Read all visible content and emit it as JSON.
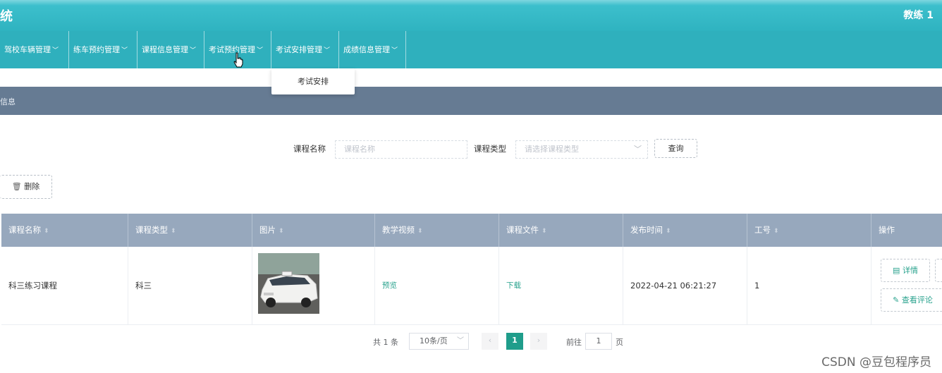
{
  "header": {
    "title": "统",
    "user": "教练 1"
  },
  "nav": {
    "items": [
      {
        "label": "驾校车辆管理"
      },
      {
        "label": "练车预约管理"
      },
      {
        "label": "课程信息管理"
      },
      {
        "label": "考试预约管理"
      },
      {
        "label": "考试安排管理"
      },
      {
        "label": "成绩信息管理"
      }
    ],
    "dropdown_item": "考试安排"
  },
  "section": {
    "title": "信息"
  },
  "search": {
    "course_name_label": "课程名称",
    "course_name_placeholder": "课程名称",
    "course_type_label": "课程类型",
    "course_type_placeholder": "请选择课程类型",
    "query_button": "查询"
  },
  "toolbar": {
    "delete_button": "删除"
  },
  "table": {
    "headers": [
      "课程名称",
      "课程类型",
      "图片",
      "教学视频",
      "课程文件",
      "发布时间",
      "工号",
      "操作"
    ],
    "rows": [
      {
        "name": "科三练习课程",
        "type": "科三",
        "video": "预览",
        "file": "下载",
        "time": "2022-04-21 06:21:27",
        "staff_no": "1",
        "detail_button": "详情",
        "comment_button": "查看评论"
      }
    ]
  },
  "pager": {
    "total": "共 1 条",
    "page_size": "10条/页",
    "prev": "‹",
    "current": "1",
    "next": "›",
    "goto_label": "前往",
    "goto_value": "1",
    "page_suffix": "页"
  },
  "watermark": "CSDN @豆包程序员",
  "colors": {
    "nav_bg": "#2fb0bd",
    "section_bg": "#667b93",
    "table_header_bg": "#97a8bd",
    "accent": "#2aa38e",
    "pager_active": "#1f9d8b"
  }
}
